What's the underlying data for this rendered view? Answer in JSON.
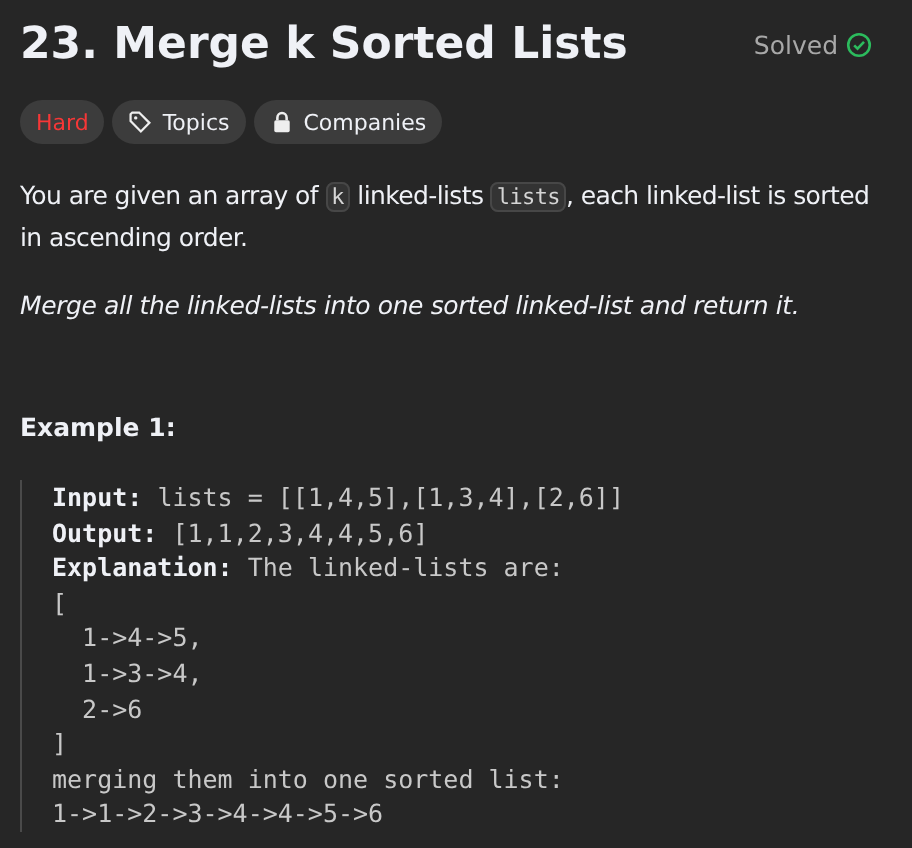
{
  "title": "23. Merge k Sorted Lists",
  "status": {
    "label": "Solved",
    "solved": true
  },
  "tags": [
    {
      "kind": "difficulty",
      "label": "Hard"
    },
    {
      "kind": "tag",
      "label": "Topics"
    },
    {
      "kind": "lock",
      "label": "Companies"
    }
  ],
  "description": [
    {
      "kind": "text",
      "text": "You are given an array of "
    },
    {
      "kind": "code",
      "text": "k"
    },
    {
      "kind": "text",
      "text": " linked-lists "
    },
    {
      "kind": "code",
      "text": "lists"
    },
    {
      "kind": "text",
      "text": ", each linked-list is sorted in ascending order."
    }
  ],
  "instruction": "Merge all the linked-lists into one sorted linked-list and return it.",
  "example": {
    "heading": "Example 1:",
    "lines": [
      {
        "label": "Input:",
        "text": "lists = [[1,4,5],[1,3,4],[2,6]]"
      },
      {
        "label": "Output:",
        "text": "[1,1,2,3,4,4,5,6]"
      },
      {
        "label": "Explanation:",
        "text": "The linked-lists are:"
      },
      {
        "text": "["
      },
      {
        "text": "  1->4->5,"
      },
      {
        "text": "  1->3->4,"
      },
      {
        "text": "  2->6"
      },
      {
        "text": "]"
      },
      {
        "text": "merging them into one sorted list:"
      },
      {
        "text": "1->1->2->3->4->4->5->6"
      }
    ]
  }
}
